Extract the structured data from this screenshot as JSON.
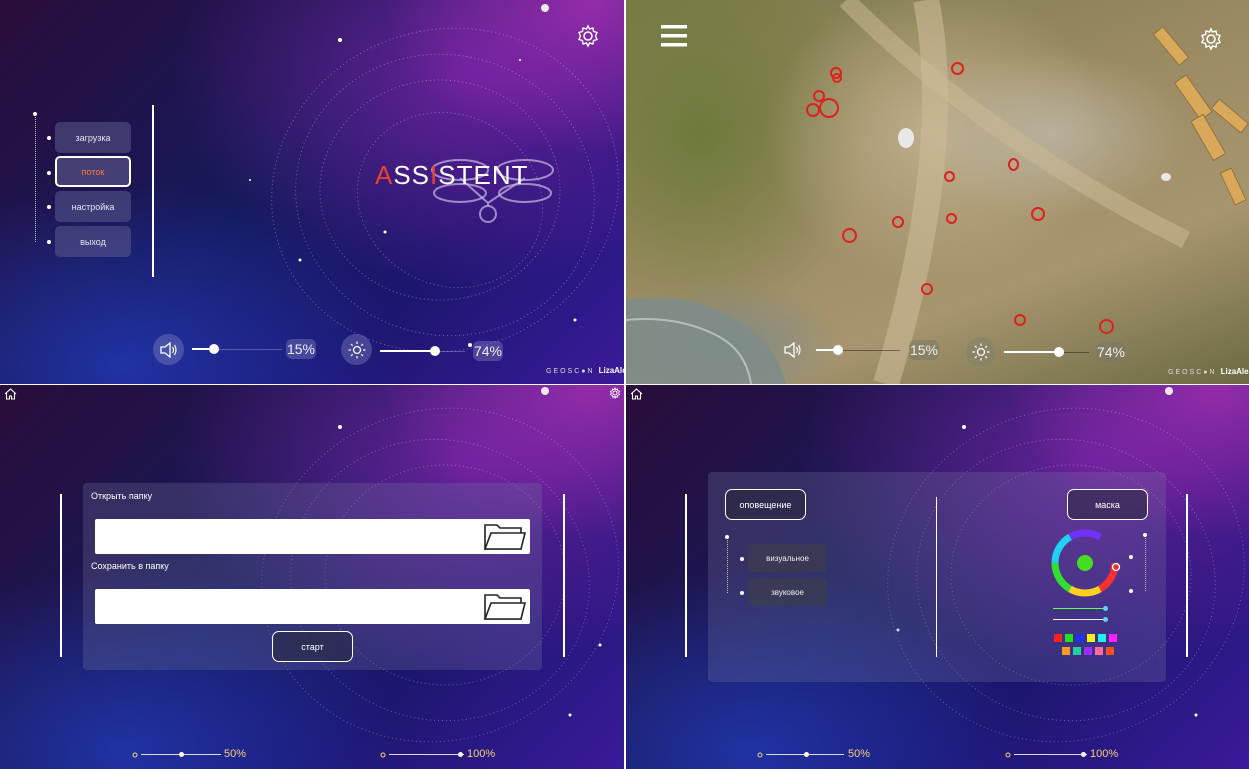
{
  "main_menu": {
    "items": [
      {
        "label": "загрузка",
        "active": false
      },
      {
        "label": "поток",
        "active": true
      },
      {
        "label": "настройка",
        "active": false
      },
      {
        "label": "выход",
        "active": false
      }
    ]
  },
  "logo": {
    "accent_a": "A",
    "part1": "SS",
    "accent_i": "I",
    "part2": "STENT"
  },
  "controls": {
    "volume": {
      "percent_label": "15%",
      "value": 0.15
    },
    "brightness": {
      "percent_label": "74%",
      "value": 0.74
    }
  },
  "brand": {
    "geoscan": "GEOSC●N",
    "lizaalert": "LizaAlert"
  },
  "file_settings": {
    "open_folder_label": "Открыть папку",
    "open_folder_value": "",
    "save_folder_label": "Сохранить в папку",
    "save_folder_value": "",
    "start_button": "старт"
  },
  "bottom_controls": {
    "left": {
      "percent_label": "50%",
      "value": 0.5
    },
    "right": {
      "percent_label": "100%",
      "value": 1.0
    }
  },
  "notification": {
    "header_button": "оповещение",
    "options": [
      "визуальное",
      "звуковое"
    ],
    "mask_button": "маска"
  },
  "colors": {
    "accent_red": "#e8432e",
    "marker_red": "#e0201e",
    "active_menu_text": "#ff7a3a",
    "palette": [
      "#ff2020",
      "#22e022",
      "#2030ff",
      "#f0f020",
      "#20f0f0",
      "#ff20ff",
      "#ff9a20",
      "#20d0a0",
      "#9a30ff",
      "#ff6a9a",
      "#ff5020"
    ]
  }
}
